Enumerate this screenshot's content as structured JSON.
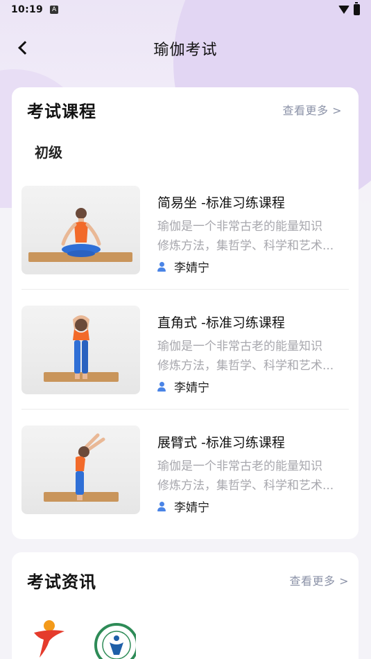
{
  "status_bar": {
    "time": "10:19",
    "notification_glyph": "A"
  },
  "nav": {
    "title": "瑜伽考试"
  },
  "exam_courses": {
    "title": "考试课程",
    "more_label": "查看更多 >",
    "level": "初级",
    "items": [
      {
        "title": "简易坐 -标准习练课程",
        "desc_line1": "瑜伽是一个非常古老的能量知识",
        "desc_line2": "修炼方法，集哲学、科学和艺术...",
        "author": "李婧宁",
        "pose": "sitting"
      },
      {
        "title": "直角式 -标准习练课程",
        "desc_line1": "瑜伽是一个非常古老的能量知识",
        "desc_line2": "修炼方法，集哲学、科学和艺术...",
        "author": "李婧宁",
        "pose": "forward-bend"
      },
      {
        "title": "展臂式 -标准习练课程",
        "desc_line1": "瑜伽是一个非常古老的能量知识",
        "desc_line2": "修炼方法，集哲学、科学和艺术...",
        "author": "李婧宁",
        "pose": "back-bend"
      }
    ]
  },
  "exam_news": {
    "title": "考试资讯",
    "more_label": "查看更多 >"
  },
  "colors": {
    "accent_blue": "#4a84e6",
    "muted_text": "#a7a7ad",
    "more_text": "#8c93a8",
    "mat": "#c9955b",
    "shirt": "#f26a2a",
    "pants": "#2f6fd6"
  }
}
